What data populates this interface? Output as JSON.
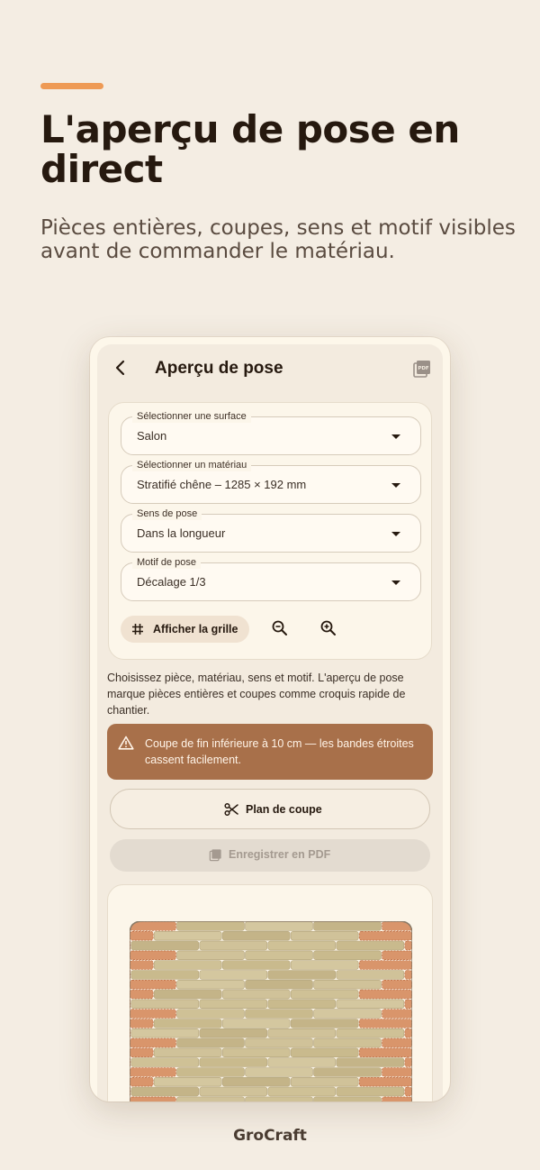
{
  "hero": {
    "title": "L'aperçu de pose en direct",
    "subtitle": "Pièces entières, coupes, sens et motif visibles avant de commander le matériau."
  },
  "appbar": {
    "title": "Aperçu de pose",
    "back_icon": "arrow-back-icon",
    "pdf_icon": "pdf-icon"
  },
  "form": {
    "surface": {
      "label": "Sélectionner une surface",
      "value": "Salon"
    },
    "material": {
      "label": "Sélectionner un matériau",
      "value": "Stratifié chêne – 1285 × 192 mm"
    },
    "direction": {
      "label": "Sens de pose",
      "value": "Dans la longueur"
    },
    "pattern": {
      "label": "Motif de pose",
      "value": "Décalage 1/3"
    },
    "grid_button": "Afficher la grille",
    "zoom_out_icon": "zoom-out-icon",
    "zoom_in_icon": "zoom-in-icon"
  },
  "info": "Choisissez pièce, matériau, sens et motif. L'aperçu de pose marque pièces entières et coupes comme croquis rapide de chantier.",
  "warning": "Coupe de fin inférieure à 10 cm — les bandes étroites cassent facilement.",
  "actions": {
    "cut_plan": "Plan de coupe",
    "save_pdf": "Enregistrer en PDF",
    "save_pdf_enabled": false
  },
  "colors": {
    "background": "#f4ede3",
    "accent": "#ee9a55",
    "warning": "#a8704a",
    "plank": "#cfc196",
    "cut_plank": "#d9956b"
  },
  "brand": "GroCraft"
}
